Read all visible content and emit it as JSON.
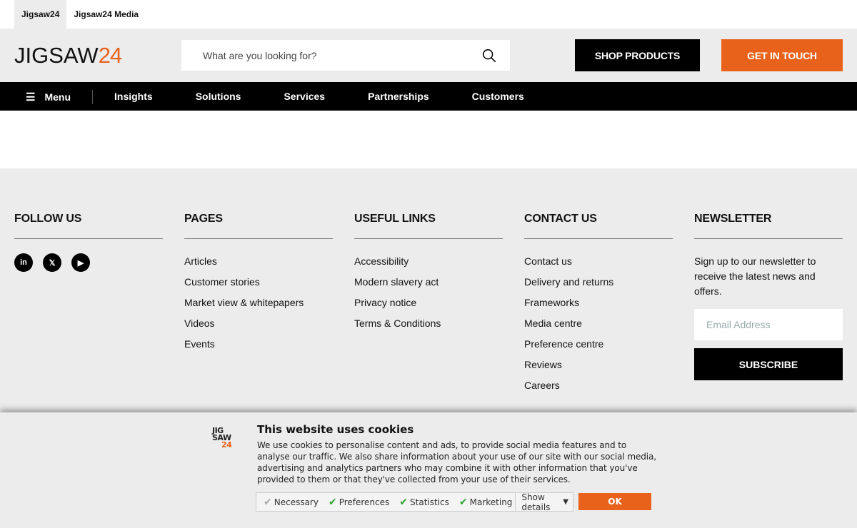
{
  "top_tabs": [
    {
      "label": "Jigsaw24"
    },
    {
      "label": "Jigsaw24 Media"
    }
  ],
  "logo": {
    "text": "JIGSAW",
    "num": "24"
  },
  "search": {
    "placeholder": "What are you looking for?"
  },
  "header": {
    "shop_label": "SHOP PRODUCTS",
    "touch_label": "GET IN TOUCH"
  },
  "colors": {
    "accent": "#e8621b",
    "nav_bg": "#000000",
    "footer_bg": "#ececec"
  },
  "nav": {
    "menu_label": "Menu",
    "items": [
      "Insights",
      "Solutions",
      "Services",
      "Partnerships",
      "Customers"
    ]
  },
  "footer": {
    "follow": {
      "title": "FOLLOW US",
      "icons": [
        "linkedin-icon",
        "x-icon",
        "youtube-icon"
      ]
    },
    "pages": {
      "title": "PAGES",
      "items": [
        "Articles",
        "Customer stories",
        "Market view & whitepapers",
        "Videos",
        "Events"
      ]
    },
    "useful": {
      "title": "USEFUL LINKS",
      "items": [
        "Accessibility",
        "Modern slavery act",
        "Privacy notice",
        "Terms & Conditions"
      ]
    },
    "contact": {
      "title": "CONTACT US",
      "items": [
        "Contact us",
        "Delivery and returns",
        "Frameworks",
        "Media centre",
        "Preference centre",
        "Reviews",
        "Careers"
      ]
    },
    "newsletter": {
      "title": "NEWSLETTER",
      "description": "Sign up to our newsletter to receive the latest news and offers.",
      "email_placeholder": "Email Address",
      "subscribe_label": "SUBSCRIBE"
    }
  },
  "cookie": {
    "logo_lines": [
      "JIG",
      "SAW",
      "24"
    ],
    "title": "This website uses cookies",
    "text": "We use cookies to personalise content and ads, to provide social media features and to analyse our traffic. We also share information about your use of our site with our social media, advertising and analytics partners who may combine it with other information that you've provided to them or that they've collected from your use of their services.",
    "checks": [
      "Necessary",
      "Preferences",
      "Statistics",
      "Marketing"
    ],
    "show_details": "Show details",
    "ok_label": "OK"
  }
}
